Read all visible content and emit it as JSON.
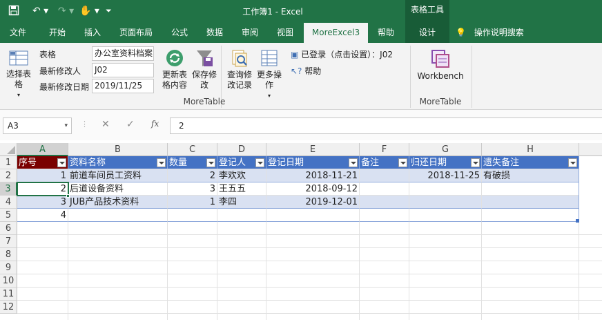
{
  "window": {
    "title": "工作簿1  -  Excel",
    "table_tools": "表格工具"
  },
  "tabs": [
    {
      "label": "文件"
    },
    {
      "label": "开始"
    },
    {
      "label": "插入"
    },
    {
      "label": "页面布局"
    },
    {
      "label": "公式"
    },
    {
      "label": "数据"
    },
    {
      "label": "审阅"
    },
    {
      "label": "视图"
    },
    {
      "label": "MoreExcel3"
    },
    {
      "label": "帮助"
    },
    {
      "label": "设计"
    }
  ],
  "tell_me": "操作说明搜索",
  "ribbon": {
    "select_table": "选择表格",
    "labels": {
      "table": "表格",
      "modifier": "最新修改人",
      "modified_date": "最新修改日期"
    },
    "values": {
      "table": "办公室资料档案",
      "modifier": "J02",
      "modified_date": "2019/11/25"
    },
    "update": "更新表格内容",
    "save": "保存修改",
    "query": "查询修改记录",
    "more": "更多操作",
    "group_moretable": "MoreTable",
    "login": "已登录（点击设置）：J02",
    "help": "帮助",
    "workbench": "Workbench",
    "group_moretable2": "MoreTable"
  },
  "formula_bar": {
    "name_box": "A3",
    "fx": "fx",
    "value": "2"
  },
  "sheet": {
    "columns": [
      "A",
      "B",
      "C",
      "D",
      "E",
      "F",
      "G",
      "H"
    ],
    "rows": [
      "1",
      "2",
      "3",
      "4",
      "5",
      "6",
      "7",
      "8",
      "9",
      "10",
      "11",
      "12"
    ],
    "headers": [
      "序号",
      "资料名称",
      "数量",
      "登记人",
      "登记日期",
      "备注",
      "归还日期",
      "遗失备注"
    ],
    "data": [
      [
        "1",
        "前道车间员工资料",
        "2",
        "李欢欢",
        "2018-11-21",
        "",
        "2018-11-25",
        "有破损"
      ],
      [
        "2",
        "后道设备资料",
        "3",
        "王五五",
        "2018-09-12",
        "",
        "",
        ""
      ],
      [
        "3",
        "JUB产品技术资料",
        "1",
        "李四",
        "2019-12-01",
        "",
        "",
        ""
      ],
      [
        "4",
        "",
        "",
        "",
        "",
        "",
        "",
        ""
      ]
    ]
  }
}
